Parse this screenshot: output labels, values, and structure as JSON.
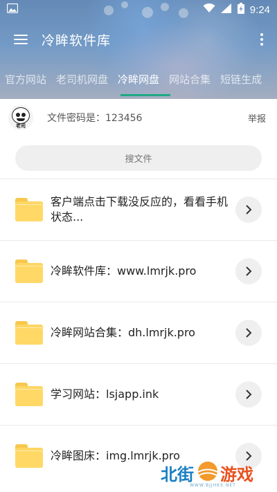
{
  "status_bar": {
    "time": "9:24"
  },
  "header": {
    "title": "冷眸软件库",
    "tabs": [
      {
        "label": "官方网站",
        "active": false
      },
      {
        "label": "老司机网盘",
        "active": false
      },
      {
        "label": "冷眸网盘",
        "active": true
      },
      {
        "label": "网站合集",
        "active": false
      },
      {
        "label": "短链生成",
        "active": false
      }
    ],
    "accent_color": "#1ea983"
  },
  "info": {
    "avatar_caption": "老司",
    "password_text": "文件密码是：123456",
    "report_label": "举报"
  },
  "search": {
    "placeholder": "搜文件"
  },
  "files": [
    {
      "name": "客户端点击下载没反应的，看看手机状态..."
    },
    {
      "name": "冷眸软件库：www.lmrjk.pro"
    },
    {
      "name": "冷眸网站合集：dh.lmrjk.pro"
    },
    {
      "name": "学习网站：lsjapp.ink"
    },
    {
      "name": "冷眸图床：img.lmrjk.pro"
    }
  ],
  "watermark": {
    "left": "北街",
    "right": "游戏",
    "sub": "WWW.BJJHKS.NET"
  }
}
